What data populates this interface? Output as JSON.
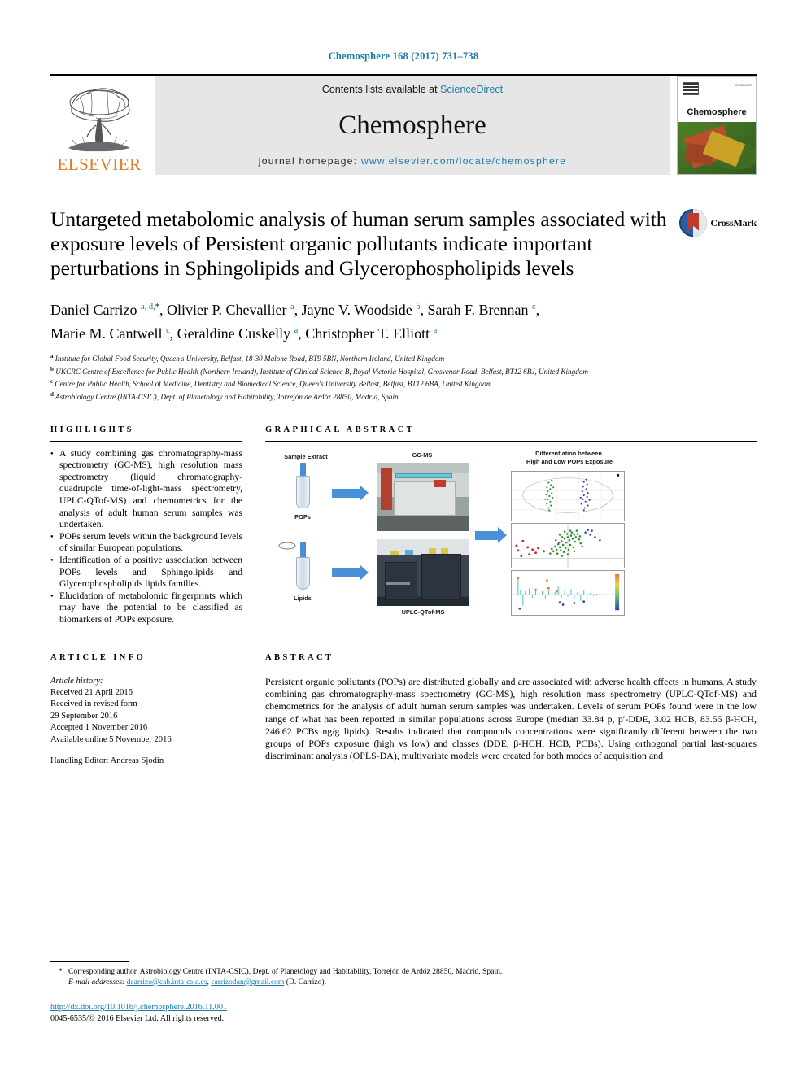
{
  "running_head": "Chemosphere 168 (2017) 731–738",
  "masthead": {
    "publisher_name": "ELSEVIER",
    "contents_prefix": "Contents lists available at ",
    "contents_link": "ScienceDirect",
    "journal_title": "Chemosphere",
    "homepage_prefix": "journal homepage: ",
    "homepage_url": "www.elsevier.com/locate/chemosphere",
    "cover_journal_name": "Chemosphere",
    "cover_issn_mark": "ELSEVIER"
  },
  "article": {
    "title": "Untargeted metabolomic analysis of human serum samples associated with exposure levels of Persistent organic pollutants indicate important perturbations in Sphingolipids and Glycerophospholipids levels",
    "crossmark_label": "CrossMark",
    "authors_line1": "Daniel Carrizo",
    "authors_html": "Daniel Carrizo <sup>a, d, *</sup>, Olivier P. Chevallier <sup>a</sup>, Jayne V. Woodside <sup>b</sup>, Sarah F. Brennan <sup>c</sup>, Marie M. Cantwell <sup>c</sup>, Geraldine Cuskelly <sup>a</sup>, Christopher T. Elliott <sup>a</sup>",
    "affiliations": [
      {
        "marker": "a",
        "text": "Institute for Global Food Security, Queen's University, Belfast, 18-30 Malone Road, BT9 5BN, Northern Ireland, United Kingdom"
      },
      {
        "marker": "b",
        "text": "UKCRC Centre of Excellence for Public Health (Northern Ireland), Institute of Clinical Science B, Royal Victoria Hospital, Grosvenor Road, Belfast, BT12 6BJ, United Kingdom"
      },
      {
        "marker": "c",
        "text": "Centre for Public Health, School of Medicine, Dentistry and Biomedical Science, Queen's University Belfast, Belfast, BT12 6BA, United Kingdom"
      },
      {
        "marker": "d",
        "text": "Astrobiology Centre (INTA-CSIC), Dept. of Planetology and Habitability, Torrejón de Ardóz 28850, Madrid, Spain"
      }
    ]
  },
  "highlights": {
    "heading": "HIGHLIGHTS",
    "items": [
      "A study combining gas chromatography-mass spectrometry (GC-MS), high resolution mass spectrometry (liquid chromatography-quadrupole time-of-light-mass spectrometry, UPLC-QTof-MS) and chemometrics for the analysis of adult human serum samples was undertaken.",
      "POPs serum levels within the background levels of similar European populations.",
      "Identification of a positive association between POPs levels and Sphingolipids and Glycerophospholipids lipids families.",
      "Elucidation of metabolomic fingerprints which may have the potential to be classified as biomarkers of POPs exposure."
    ]
  },
  "graphical_abstract": {
    "heading": "GRAPHICAL ABSTRACT",
    "labels": {
      "sample_extract": "Sample Extract",
      "pops": "POPs",
      "lipids": "Lipids",
      "gcms": "GC-MS",
      "uplc": "UPLC-QTof-MS",
      "results_title_line1": "Differentiation between",
      "results_title_line2": "High and Low POPs Exposure"
    },
    "colors": {
      "arrow": "#4a90d9",
      "group_high": "#2f6fd0",
      "group_low": "#2e8b2e",
      "outlier": "#d62728"
    }
  },
  "article_info": {
    "heading": "ARTICLE INFO",
    "history_label": "Article history:",
    "history": [
      "Received 21 April 2016",
      "Received in revised form",
      "29 September 2016",
      "Accepted 1 November 2016",
      "Available online 5 November 2016"
    ],
    "handling_editor": "Handling Editor: Andreas Sjodin"
  },
  "abstract": {
    "heading": "ABSTRACT",
    "text": "Persistent organic pollutants (POPs) are distributed globally and are associated with adverse health effects in humans. A study combining gas chromatography-mass spectrometry (GC-MS), high resolution mass spectrometry (UPLC-QTof-MS) and chemometrics for the analysis of adult human serum samples was undertaken. Levels of serum POPs found were in the low range of what has been reported in similar populations across Europe (median 33.84 p, p′-DDE, 3.02 HCB, 83.55 β-HCH, 246.62 PCBs ng/g lipids). Results indicated that compounds concentrations were significantly different between the two groups of POPs exposure (high vs low) and classes (DDE, β-HCH, HCB, PCBs). Using orthogonal partial last-squares discriminant analysis (OPLS-DA), multivariate models were created for both modes of acquisition and"
  },
  "footnotes": {
    "corresponding_marker": "*",
    "corresponding_text": "Corresponding author. Astrobiology Centre (INTA-CSIC), Dept. of Planetology and Habitability, Torrejón de Ardóz 28850, Madrid, Spain.",
    "email_label": "E-mail addresses:",
    "email1": "dcarrizo@cab.inta-csic.es",
    "email2": "carrizodan@gmail.com",
    "email_suffix": "(D. Carrizo).",
    "doi_url": "http://dx.doi.org/10.1016/j.chemosphere.2016.11.001",
    "copyright": "0045-6535/© 2016 Elsevier Ltd. All rights reserved."
  }
}
